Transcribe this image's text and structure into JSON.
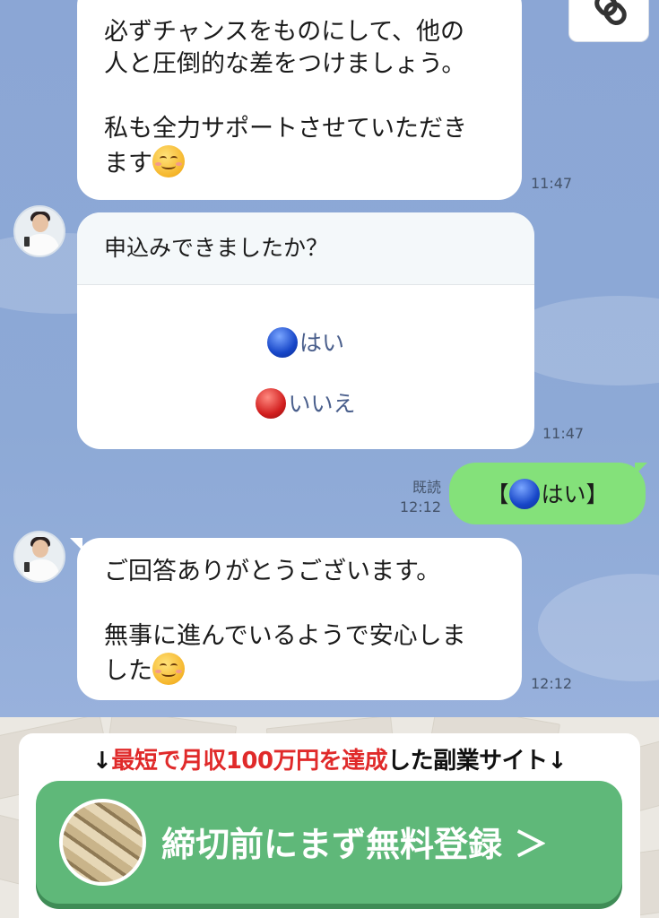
{
  "messages": [
    {
      "sender": "other",
      "lines": [
        "必ずチャンスをものにして、他の",
        "人と圧倒的な差をつけましょう。",
        "",
        "私も全力サポートさせていただき",
        "ます"
      ],
      "emoji": "smiling-face-emoji",
      "time": "11:47"
    },
    {
      "sender": "other",
      "type": "question-card",
      "question": "申込みできましたか？",
      "options": [
        {
          "icon": "blue-circle-emoji",
          "label": "はい"
        },
        {
          "icon": "red-circle-emoji",
          "label": "いいえ"
        }
      ],
      "time": "11:47"
    },
    {
      "sender": "me",
      "text_left": "【",
      "icon": "blue-circle-emoji",
      "text_mid": "はい】",
      "read_label": "既読",
      "time": "12:12"
    },
    {
      "sender": "other",
      "lines": [
        "ご回答ありがとうございます。",
        "",
        "無事に進んでいるようで安心しま",
        "した"
      ],
      "emoji": "smiling-face-emoji",
      "time": "12:12"
    }
  ],
  "banner": {
    "arrow_left": "↓",
    "headline_red_1": "最短で月収100万円を達成",
    "headline_black": "した副業サイト",
    "arrow_right": "↓",
    "cta_label": "締切前にまず無料登録 ＞"
  },
  "colors": {
    "chat_background": "#8ba6d5",
    "outgoing_bubble": "#84e17a",
    "cta_green": "#5fb879",
    "headline_red": "#e02a2a"
  }
}
